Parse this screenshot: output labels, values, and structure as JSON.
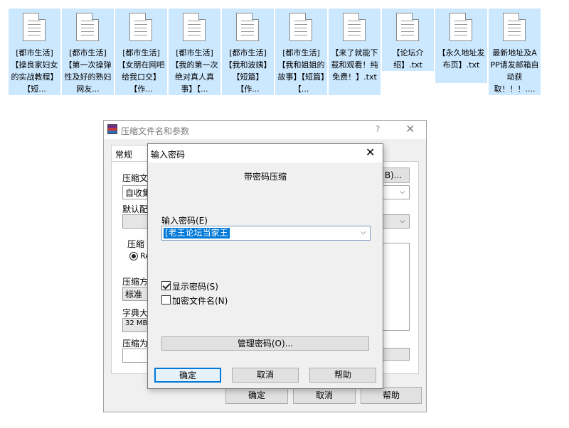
{
  "files": [
    {
      "name": "[都市生活]【操良家妇女的实战教程】【短..."
    },
    {
      "name": "[都市生活]【第一次操弹性及好的熟妇网友..."
    },
    {
      "name": "[都市生活]【女朋在网吧给我口交】【作..."
    },
    {
      "name": "[都市生活]【我的第一次绝对真人真事】【..."
    },
    {
      "name": "[都市生活]【我和波姨】【短篇】【作..."
    },
    {
      "name": "[都市生活]【我和姐姐的故事】【短篇】【..."
    },
    {
      "name": "【来了就能下载和观看！纯免费！】.txt"
    },
    {
      "name": "【论坛介绍】.txt"
    },
    {
      "name": "【永久地址发布页】.txt"
    },
    {
      "name": "最新地址及APP请发邮箱自动获取！！！...."
    }
  ],
  "back_dialog": {
    "title": "压缩文件名和参数",
    "help": "?",
    "close": "✕",
    "tab_normal": "常规",
    "archive_name_label": "压缩文",
    "archive_name_value": "自收集",
    "browse_button": "B)...",
    "profile_label": "默认配",
    "format_label": "压缩",
    "format_rar": "RA",
    "method_label": "压缩方",
    "method_value": "标准",
    "dict_label": "字典大",
    "dict_value": "32 MB",
    "split_label": "压缩为",
    "ok": "确定",
    "cancel": "取消",
    "help_button": "帮助"
  },
  "password_dialog": {
    "title": "输入密码",
    "close": "✕",
    "subtitle": "带密码压缩",
    "enter_label": "输入密码(E)",
    "password_value": "[老王论坛当家王",
    "show_password": "显示密码(S)",
    "show_password_checked": true,
    "encrypt_names": "加密文件名(N)",
    "encrypt_names_checked": false,
    "manage_button": "管理密码(O)...",
    "ok": "确定",
    "cancel": "取消",
    "help": "帮助"
  }
}
